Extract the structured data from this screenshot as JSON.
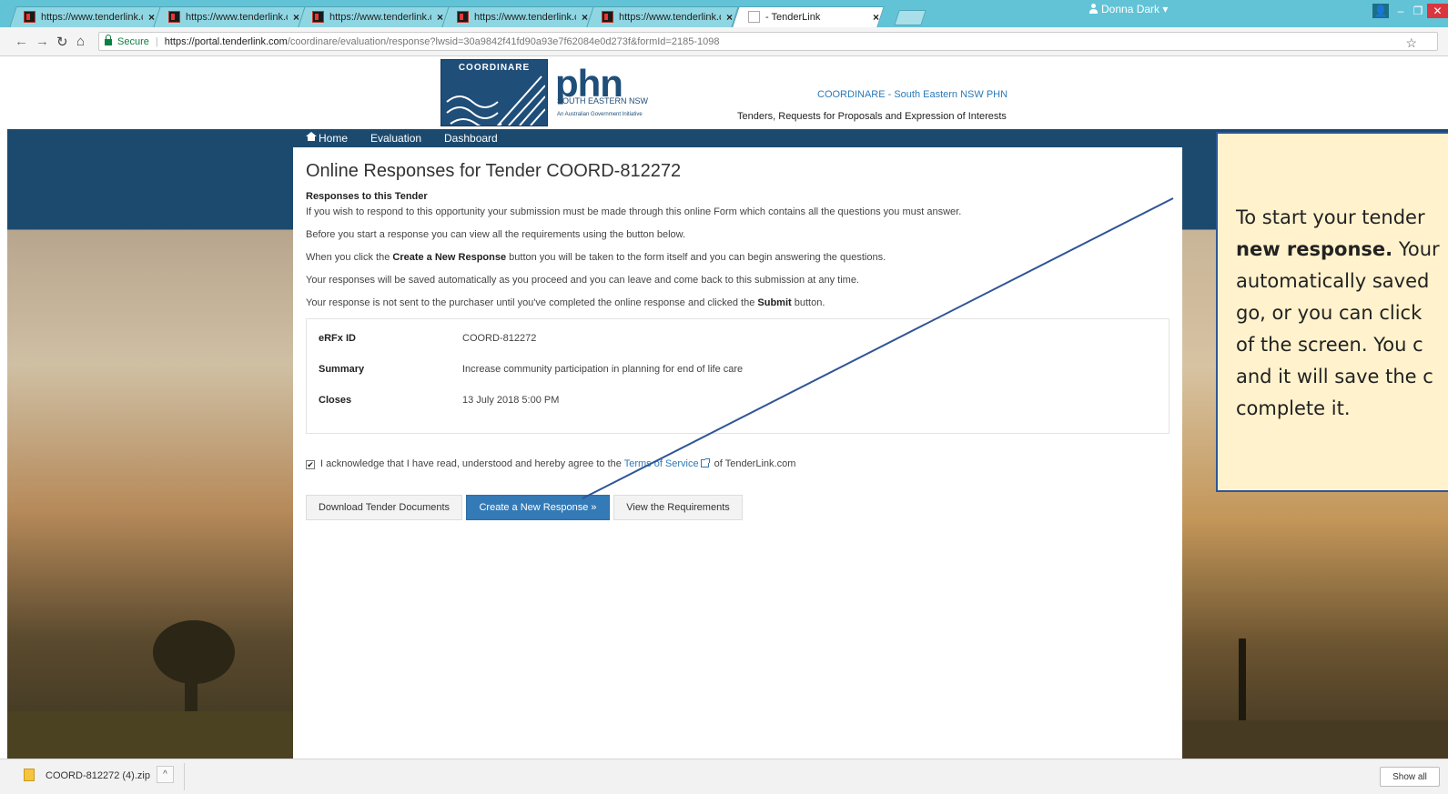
{
  "browser": {
    "tabs": [
      {
        "title": "https://www.tenderlink.co",
        "close": "×"
      },
      {
        "title": "https://www.tenderlink.co",
        "close": "×"
      },
      {
        "title": "https://www.tenderlink.co",
        "close": "×"
      },
      {
        "title": "https://www.tenderlink.co",
        "close": "×"
      },
      {
        "title": "https://www.tenderlink.co",
        "close": "×"
      },
      {
        "title": "- TenderLink",
        "close": "×"
      }
    ],
    "secure_label": "Secure",
    "url_host": "https://portal.tenderlink.com",
    "url_path": "/coordinare/evaluation/response?lwsid=30a9842f41fd90a93e7f62084e0d273f&formId=2185-1098",
    "bookmark_icon": "☆"
  },
  "header": {
    "logo_label": "COORDINARE",
    "phn_text": "phn",
    "phn_subtitle": "SOUTH EASTERN NSW",
    "phn_tagline": "An Australian Government Initiative",
    "org_name": "COORDINARE - South Eastern NSW PHN",
    "org_subtitle": "Tenders, Requests for Proposals and Expression of Interests"
  },
  "nav": {
    "home": "Home",
    "evaluation": "Evaluation",
    "dashboard": "Dashboard",
    "user": "Donna Dark"
  },
  "content": {
    "title": "Online Responses for Tender COORD-812272",
    "subheading": "Responses to this Tender",
    "p1": "If you wish to respond to this opportunity your submission must be made through this online Form which contains all the questions you must answer.",
    "p2": "Before you start a response you can view all the requirements using the button below.",
    "p3_a": "When you click the ",
    "p3_b": "Create a New Response",
    "p3_c": " button you will be taken to the form itself and you can begin answering the questions.",
    "p4": "Your responses will be saved automatically as you proceed and you can leave and come back to this submission at any time.",
    "p5_a": "Your response is not sent to the purchaser until you've completed the online response and clicked the ",
    "p5_b": "Submit",
    "p5_c": " button.",
    "details": [
      {
        "label": "eRFx ID",
        "value": "COORD-812272"
      },
      {
        "label": "Summary",
        "value": "Increase community participation in planning for end of life care"
      },
      {
        "label": "Closes",
        "value": "13 July 2018 5:00 PM"
      }
    ],
    "ack_a": "I acknowledge that I have read, understood and hereby agree to the ",
    "ack_link": "Terms of Service",
    "ack_b": " of TenderLink.com",
    "ack_checked": "✔",
    "btn_download": "Download Tender Documents",
    "btn_create": "Create a New Response »",
    "btn_view": "View the Requirements"
  },
  "callout": {
    "line1": "To start your tender",
    "line2_bold": "new response.",
    "line2_rest": " Your",
    "line3": "automatically saved",
    "line4": "go, or you can click",
    "line5": "of the screen. You c",
    "line6": "and it will save the c",
    "line7": "complete it."
  },
  "downloads": {
    "file": "COORD-812272 (4).zip",
    "chevron": "^",
    "show_all": "Show all"
  },
  "colors": {
    "navy": "#1c4a6e",
    "primary_button": "#337ab7",
    "callout_fill": "#fff2cc",
    "callout_border": "#2f5597",
    "tabbar": "#62c3d6"
  }
}
